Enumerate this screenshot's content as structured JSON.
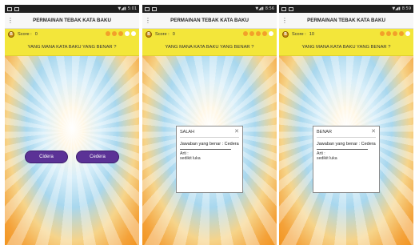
{
  "screens": [
    {
      "status": {
        "left": "▣",
        "time": "5:01"
      },
      "title": "PERMAINAN TEBAK KATA BAKU",
      "score_label": "Score :",
      "score_value": "0",
      "question": "YANG MANA KATA BAKU YANG BENAR ?",
      "options": [
        "Cidera",
        "Cedera"
      ]
    },
    {
      "status": {
        "left": "▣",
        "time": "8:56"
      },
      "title": "PERMAINAN TEBAK KATA BAKU",
      "score_label": "Score :",
      "score_value": "0",
      "question": "YANG MANA KATA BAKU YANG BENAR ?",
      "dialog": {
        "title": "SALAH",
        "answer": "Jawaban yang benar : Cedera",
        "arti_label": "Arti :",
        "meaning": "sedikit luka"
      }
    },
    {
      "status": {
        "left": "▣",
        "time": "8:59"
      },
      "title": "PERMAINAN TEBAK KATA BAKU",
      "score_label": "Score :",
      "score_value": "10",
      "question": "YANG MANA KATA BAKU YANG BENAR ?",
      "dialog": {
        "title": "BENAR",
        "answer": "Jawaban yang benar : Cedera",
        "arti_label": "Arti :",
        "meaning": "sedikit luka"
      }
    }
  ],
  "coin_letter": "B",
  "colors": {
    "yellow_bar": "#f3e63a",
    "button": "#5b3296",
    "life_dot": "#f2a02a"
  },
  "icons": {
    "menu": "menu-icon",
    "close": "close-icon",
    "coin": "coin-icon",
    "life": "life-dot-icon"
  }
}
